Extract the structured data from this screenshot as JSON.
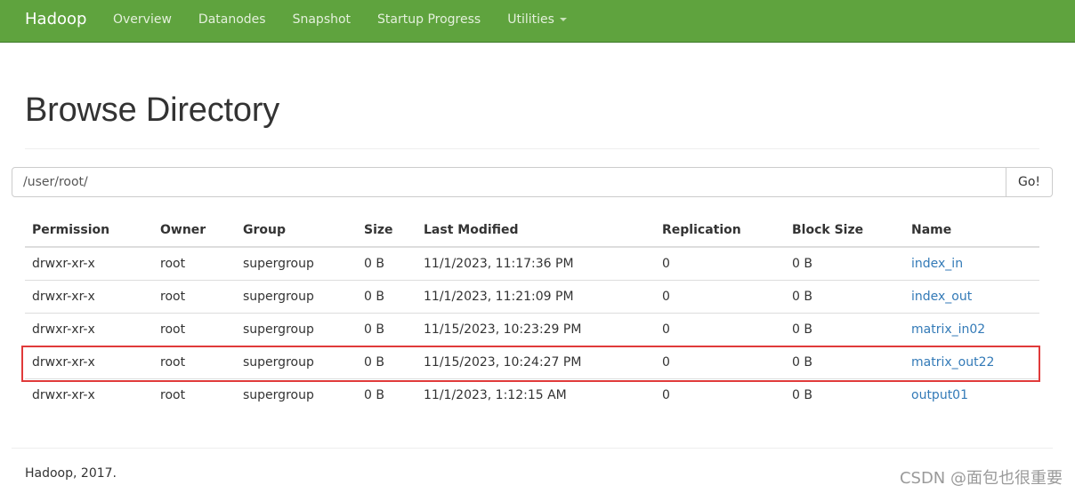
{
  "navbar": {
    "brand": "Hadoop",
    "links": [
      "Overview",
      "Datanodes",
      "Snapshot",
      "Startup Progress",
      "Utilities"
    ]
  },
  "page": {
    "title": "Browse Directory"
  },
  "path_bar": {
    "value": "/user/root/",
    "button_label": "Go!"
  },
  "table": {
    "headers": [
      "Permission",
      "Owner",
      "Group",
      "Size",
      "Last Modified",
      "Replication",
      "Block Size",
      "Name"
    ],
    "rows": [
      {
        "permission": "drwxr-xr-x",
        "owner": "root",
        "group": "supergroup",
        "size": "0 B",
        "modified": "11/1/2023, 11:17:36 PM",
        "replication": "0",
        "block_size": "0 B",
        "name": "index_in"
      },
      {
        "permission": "drwxr-xr-x",
        "owner": "root",
        "group": "supergroup",
        "size": "0 B",
        "modified": "11/1/2023, 11:21:09 PM",
        "replication": "0",
        "block_size": "0 B",
        "name": "index_out"
      },
      {
        "permission": "drwxr-xr-x",
        "owner": "root",
        "group": "supergroup",
        "size": "0 B",
        "modified": "11/15/2023, 10:23:29 PM",
        "replication": "0",
        "block_size": "0 B",
        "name": "matrix_in02"
      },
      {
        "permission": "drwxr-xr-x",
        "owner": "root",
        "group": "supergroup",
        "size": "0 B",
        "modified": "11/15/2023, 10:24:27 PM",
        "replication": "0",
        "block_size": "0 B",
        "name": "matrix_out22"
      },
      {
        "permission": "drwxr-xr-x",
        "owner": "root",
        "group": "supergroup",
        "size": "0 B",
        "modified": "11/1/2023, 1:12:15 AM",
        "replication": "0",
        "block_size": "0 B",
        "name": "output01"
      }
    ]
  },
  "footer": {
    "text": "Hadoop, 2017."
  },
  "watermark": "CSDN @面包也很重要",
  "colors": {
    "navbar": "#5fa33e",
    "link": "#337ab7",
    "highlight": "#e03a3a"
  }
}
